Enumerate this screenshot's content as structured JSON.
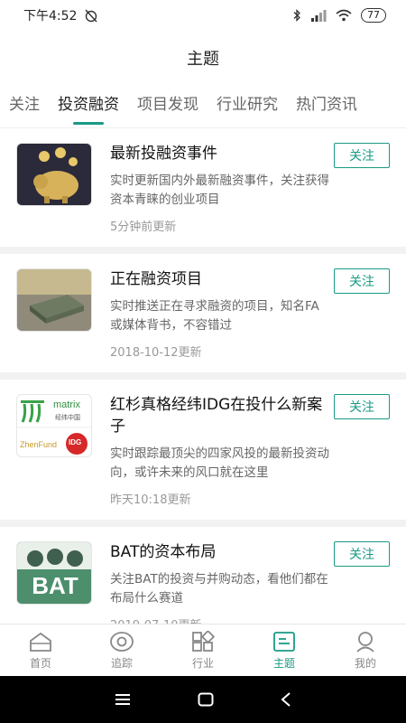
{
  "status": {
    "time": "下午4:52",
    "battery": "77"
  },
  "header": {
    "title": "主题"
  },
  "tabs": [
    {
      "label": "关注"
    },
    {
      "label": "投资融资"
    },
    {
      "label": "项目发现"
    },
    {
      "label": "行业研究"
    },
    {
      "label": "热门资讯"
    }
  ],
  "cards": [
    {
      "title": "最新投融资事件",
      "desc": "实时更新国内外最新融资事件，关注获得资本青睐的创业项目",
      "time": "5分钟前更新",
      "follow": "关注"
    },
    {
      "title": "正在融资项目",
      "desc": "实时推送正在寻求融资的项目，知名FA或媒体背书，不容错过",
      "time": "2018-10-12更新",
      "follow": "关注"
    },
    {
      "title": "红杉真格经纬IDG在投什么新案子",
      "desc": "实时跟踪最顶尖的四家风投的最新投资动向，或许未来的风口就在这里",
      "time": "昨天10:18更新",
      "follow": "关注",
      "logo_texts": {
        "matrix": "matrix",
        "matrix_cn": "经纬中国",
        "zhenfund": "ZhenFund",
        "idg": "IDG"
      }
    },
    {
      "title": "BAT的资本布局",
      "desc": "关注BAT的投资与并购动态，看他们都在布局什么赛道",
      "time": "2019-07-10更新",
      "follow": "关注",
      "logo_texts": {
        "bat": "BAT"
      }
    }
  ],
  "nav": [
    {
      "label": "首页",
      "icon": "home-icon"
    },
    {
      "label": "追踪",
      "icon": "eye-icon"
    },
    {
      "label": "行业",
      "icon": "grid-icon"
    },
    {
      "label": "主题",
      "icon": "topic-icon"
    },
    {
      "label": "我的",
      "icon": "person-icon"
    }
  ],
  "colors": {
    "accent": "#1a9a86"
  }
}
